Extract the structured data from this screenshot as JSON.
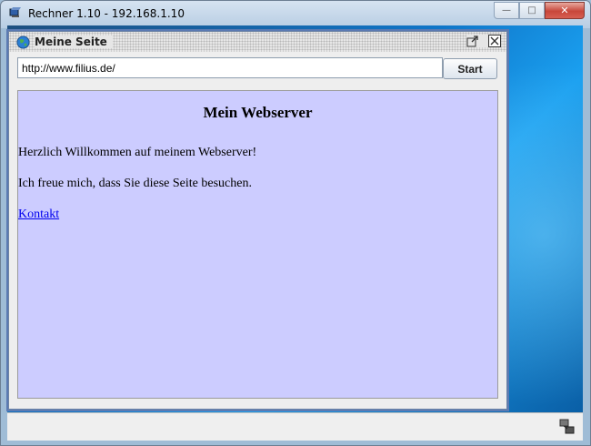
{
  "window": {
    "title": "Rechner 1.10 - 192.168.1.10",
    "minimize_glyph": "—",
    "maximize_glyph": "□",
    "close_glyph": "✕"
  },
  "browser": {
    "title": "Meine Seite",
    "url": "http://www.filius.de/",
    "start_label": "Start"
  },
  "page": {
    "heading": "Mein Webserver",
    "paragraphs": [
      "Herzlich Willkommen auf meinem Webserver!",
      "Ich freue mich, dass Sie diese Seite besuchen."
    ],
    "link_text": "Kontakt"
  },
  "colors": {
    "page_background": "#ccccff",
    "link": "#0000ee",
    "frame_border": "#5b7ab2"
  },
  "icons": [
    "app-icon",
    "minimize-icon",
    "maximize-icon",
    "close-icon",
    "globe-icon",
    "detach-icon",
    "close-icon",
    "tray-icon"
  ]
}
